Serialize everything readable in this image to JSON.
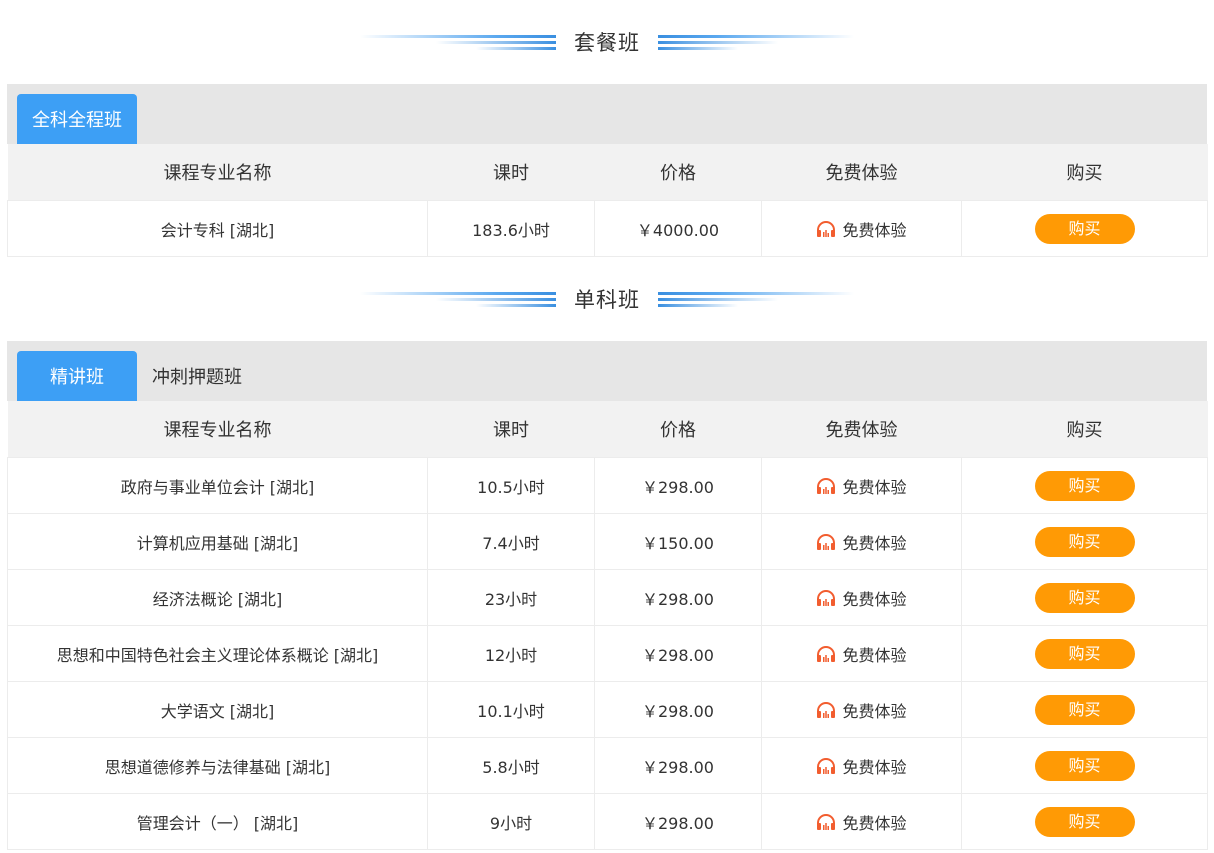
{
  "colors": {
    "tab_active": "#3d9ff5",
    "price": "#f25d2f",
    "buy_button": "#ff9a05",
    "headphone_icon": "#f25d2f"
  },
  "package_section": {
    "title": "套餐班",
    "tabs": [
      {
        "label": "全科全程班",
        "active": true
      }
    ],
    "headers": {
      "name": "课程专业名称",
      "hours": "课时",
      "price": "价格",
      "trial": "免费体验",
      "buy": "购买"
    },
    "rows": [
      {
        "name": "会计专科 [湖北]",
        "hours": "183.6小时",
        "price": "￥4000.00",
        "trial": "免费体验",
        "buy": "购买"
      }
    ]
  },
  "single_section": {
    "title": "单科班",
    "tabs": [
      {
        "label": "精讲班",
        "active": true
      },
      {
        "label": "冲刺押题班",
        "active": false
      }
    ],
    "headers": {
      "name": "课程专业名称",
      "hours": "课时",
      "price": "价格",
      "trial": "免费体验",
      "buy": "购买"
    },
    "rows": [
      {
        "name": "政府与事业单位会计 [湖北]",
        "hours": "10.5小时",
        "price": "￥298.00",
        "trial": "免费体验",
        "buy": "购买"
      },
      {
        "name": "计算机应用基础 [湖北]",
        "hours": "7.4小时",
        "price": "￥150.00",
        "trial": "免费体验",
        "buy": "购买"
      },
      {
        "name": "经济法概论 [湖北]",
        "hours": "23小时",
        "price": "￥298.00",
        "trial": "免费体验",
        "buy": "购买"
      },
      {
        "name": "思想和中国特色社会主义理论体系概论 [湖北]",
        "hours": "12小时",
        "price": "￥298.00",
        "trial": "免费体验",
        "buy": "购买"
      },
      {
        "name": "大学语文 [湖北]",
        "hours": "10.1小时",
        "price": "￥298.00",
        "trial": "免费体验",
        "buy": "购买"
      },
      {
        "name": "思想道德修养与法律基础 [湖北]",
        "hours": "5.8小时",
        "price": "￥298.00",
        "trial": "免费体验",
        "buy": "购买"
      },
      {
        "name": "管理会计（一） [湖北]",
        "hours": "9小时",
        "price": "￥298.00",
        "trial": "免费体验",
        "buy": "购买"
      }
    ]
  }
}
